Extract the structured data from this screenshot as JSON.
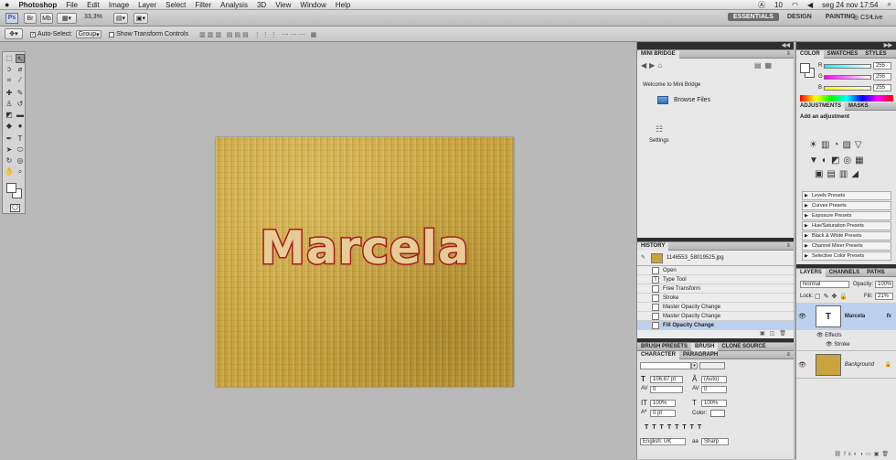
{
  "menubar": {
    "items": [
      "Photoshop",
      "File",
      "Edit",
      "Image",
      "Layer",
      "Select",
      "Filter",
      "Analysis",
      "3D",
      "View",
      "Window",
      "Help"
    ],
    "status": [
      "10",
      "seg 24 nov  17:54"
    ]
  },
  "appbar": {
    "zoom": "33,3%",
    "workspaces": [
      "ESSENTIALS",
      "DESIGN",
      "PAINTING"
    ],
    "more": "»",
    "cslive": "CS Live"
  },
  "options": {
    "auto_select": "Auto-Select:",
    "group": "Group",
    "transform": "Show Transform Controls"
  },
  "canvas": {
    "text": "Marcela",
    "bg_color": "#c9a43d",
    "text_color": "#e7cc95",
    "stroke_color": "#b01d22"
  },
  "minibridge": {
    "title": "MINI BRIDGE",
    "welcome": "Welcome to Mini Bridge",
    "browse": "Browse Files",
    "settings": "Settings"
  },
  "color": {
    "tabs": [
      "COLOR",
      "SWATCHES",
      "STYLES"
    ],
    "channels": [
      {
        "k": "R",
        "v": "255"
      },
      {
        "k": "G",
        "v": "255"
      },
      {
        "k": "B",
        "v": "255"
      }
    ]
  },
  "adjustments": {
    "tabs": [
      "ADJUSTMENTS",
      "MASKS"
    ],
    "heading": "Add an adjustment",
    "presets": [
      "Levels Presets",
      "Curves Presets",
      "Exposure Presets",
      "Hue/Saturation Presets",
      "Black & White Presets",
      "Channel Mixer Presets",
      "Selective Color Presets"
    ]
  },
  "history": {
    "title": "HISTORY",
    "snapshot": "1146553_58019525.jpg",
    "items": [
      "Open",
      "Type Tool",
      "Free Transform",
      "Stroke",
      "Master Opacity Change",
      "Master Opacity Change",
      "Fill Opacity Change"
    ]
  },
  "brushtabs": [
    "BRUSH PRESETS",
    "BRUSH",
    "CLONE SOURCE"
  ],
  "character": {
    "tabs": [
      "CHARACTER",
      "PARAGRAPH"
    ],
    "size": "106,87 pt",
    "leading": "(Auto)",
    "kerning": "0",
    "tracking": "0",
    "vscale": "100%",
    "hscale": "100%",
    "baseline": "0 pt",
    "color_label": "Color:",
    "lang": "English: UK",
    "aa": "Sharp",
    "aa_label": "aa"
  },
  "layers": {
    "tabs": [
      "LAYERS",
      "CHANNELS",
      "PATHS"
    ],
    "mode": "Normal",
    "opacity_label": "Opacity:",
    "opacity": "100%",
    "lock_label": "Lock:",
    "fill_label": "Fill:",
    "fill": "21%",
    "text_layer": "Marcela",
    "fx": "fx",
    "effects": "Effects",
    "stroke": "Stroke",
    "bg_layer": "Background",
    "thumb_T": "T"
  }
}
